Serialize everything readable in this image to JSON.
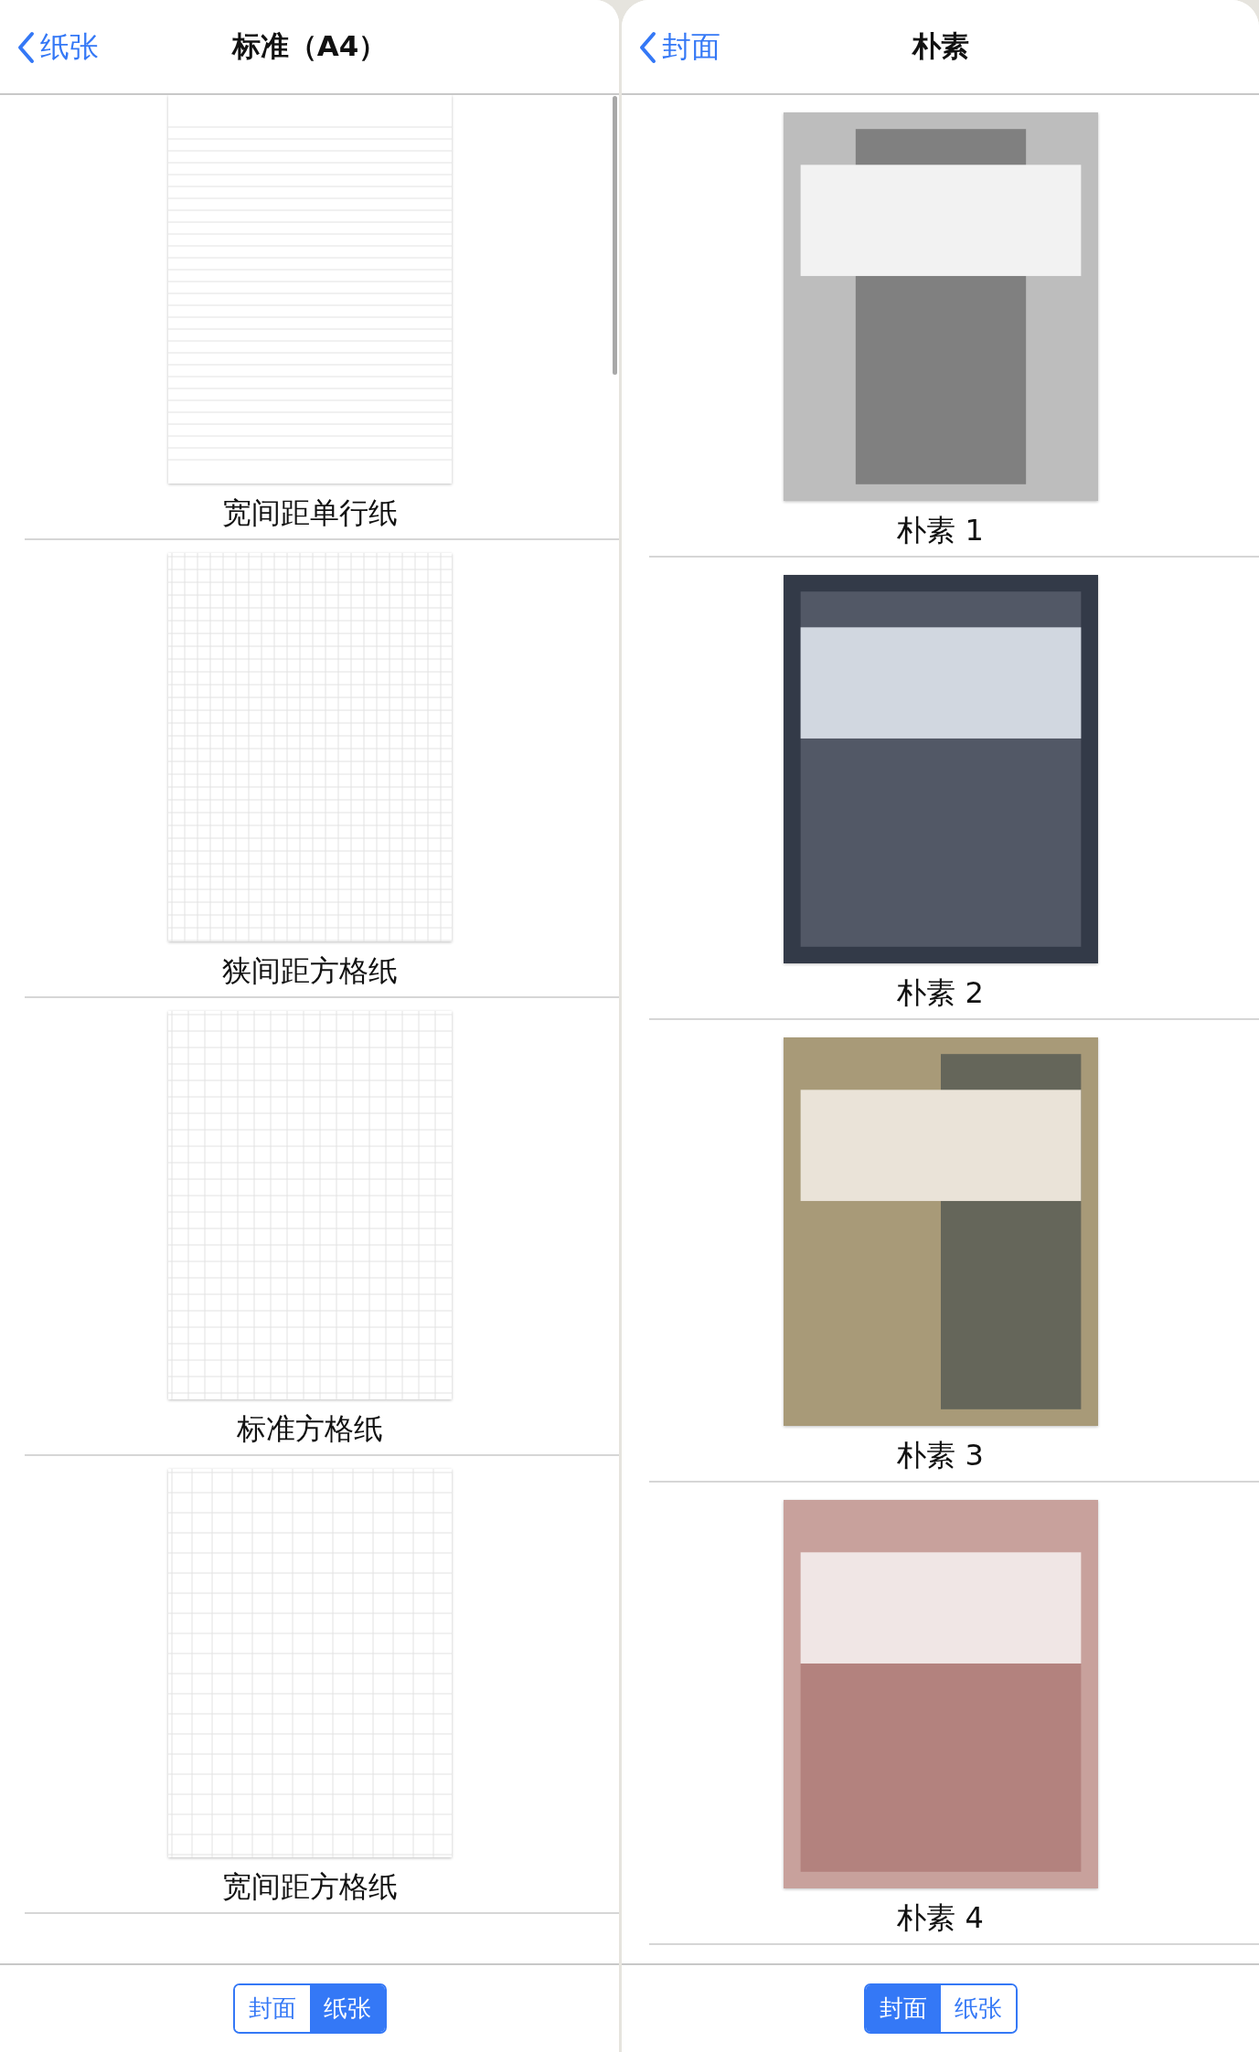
{
  "panels": [
    {
      "back": "纸张",
      "title": "标准（A4）",
      "kind": "papers",
      "items": [
        {
          "label": "宽间距单行纸",
          "kind": "lined-wide"
        },
        {
          "label": "狭间距方格纸",
          "kind": "grid-narrow"
        },
        {
          "label": "标准方格纸",
          "kind": "grid-standard"
        },
        {
          "label": "宽间距方格纸",
          "kind": "grid-wide"
        }
      ],
      "segments": [
        {
          "label": "封面",
          "selected": false
        },
        {
          "label": "纸张",
          "selected": true
        }
      ]
    },
    {
      "back": "封面",
      "title": "朴素",
      "kind": "covers",
      "items": [
        {
          "label": "朴素 1",
          "kind": "center-column",
          "color": "#bdbdbd"
        },
        {
          "label": "朴素 2",
          "kind": "inset-panel",
          "color": "#333a48"
        },
        {
          "label": "朴素 3",
          "kind": "right-column",
          "color": "#a89a78"
        },
        {
          "label": "朴素 4",
          "kind": "lower-panel",
          "color": "#c8a19c"
        }
      ],
      "segments": [
        {
          "label": "封面",
          "selected": true
        },
        {
          "label": "纸张",
          "selected": false
        }
      ]
    }
  ]
}
